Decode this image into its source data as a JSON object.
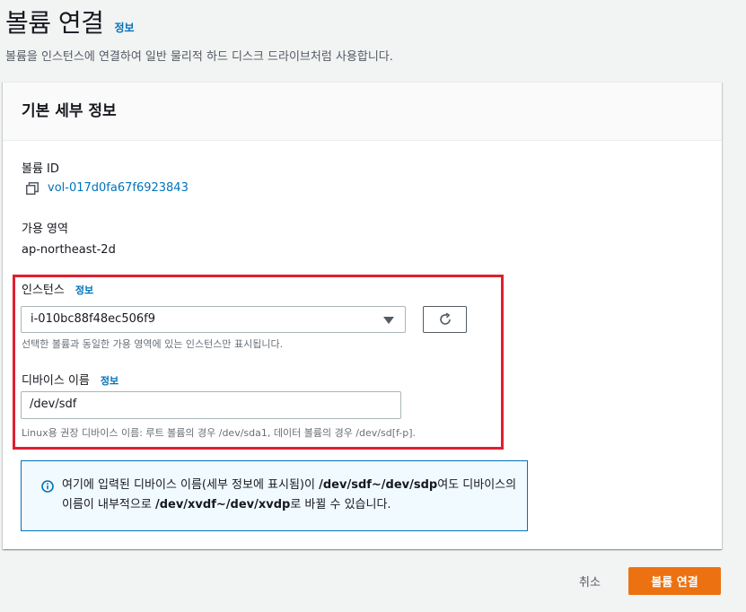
{
  "header": {
    "title": "볼륨 연결",
    "info": "정보",
    "description": "볼륨을 인스턴스에 연결하여 일반 물리적 하드 디스크 드라이브처럼 사용합니다."
  },
  "card": {
    "title": "기본 세부 정보",
    "volume_id_label": "볼륨 ID",
    "volume_id": "vol-017d0fa67f6923843",
    "az_label": "가용 영역",
    "az_value": "ap-northeast-2d",
    "instance_label": "인스턴스",
    "instance_info": "정보",
    "instance_value": "i-010bc88f48ec506f9",
    "instance_hint": "선택한 볼륨과 동일한 가용 영역에 있는 인스턴스만 표시됩니다.",
    "device_label": "디바이스 이름",
    "device_info": "정보",
    "device_value": "/dev/sdf",
    "device_hint": "Linux용 권장 디바이스 이름: 루트 볼륨의 경우 /dev/sda1, 데이터 볼륨의 경우 /dev/sd[f-p]."
  },
  "alert": {
    "t1": "여기에 입력된 디바이스 이름(세부 정보에 표시됨)이 ",
    "b1": "/dev/sdf~/dev/sdp",
    "t2": "여도 디바이스의 이름이 내부적으로 ",
    "b2": "/dev/xvdf~/dev/xvdp",
    "t3": "로 바뀔 수 있습니다."
  },
  "footer": {
    "cancel": "취소",
    "submit": "볼륨 연결"
  },
  "colors": {
    "primary": "#ec7211",
    "link": "#0073bb",
    "highlight": "#e01e2f"
  }
}
